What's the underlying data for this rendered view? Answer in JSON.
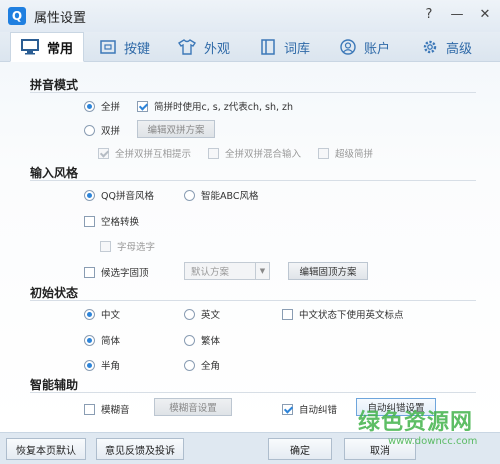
{
  "window": {
    "logo": "Q",
    "title": "属性设置",
    "controls": [
      "?",
      "—",
      "✕"
    ]
  },
  "tabs": [
    {
      "label": "常用",
      "icon": "monitor-icon",
      "active": true
    },
    {
      "label": "按键",
      "icon": "keyboard-icon",
      "active": false
    },
    {
      "label": "外观",
      "icon": "shirt-icon",
      "active": false
    },
    {
      "label": "词库",
      "icon": "book-icon",
      "active": false
    },
    {
      "label": "账户",
      "icon": "user-icon",
      "active": false
    },
    {
      "label": "高级",
      "icon": "gear-icon",
      "active": false
    }
  ],
  "sections": {
    "pinyin_mode": {
      "title": "拼音模式",
      "quanpin": "全拼",
      "shuangpin": "双拼",
      "jianpin_option": "简拼时使用c, s, z代表ch, sh, zh",
      "edit_shuangpin": "编辑双拼方案",
      "sub_options": [
        "全拼双拼互相提示",
        "全拼双拼混合输入",
        "超级简拼"
      ]
    },
    "input_style": {
      "title": "输入风格",
      "qq_style": "QQ拼音风格",
      "abc_style": "智能ABC风格",
      "space_convert": "空格转换",
      "letter_select": "字母选字",
      "candidate_fixed": "候选字固顶",
      "scheme_select": "默认方案",
      "edit_fixed_scheme": "编辑固顶方案"
    },
    "initial_state": {
      "title": "初始状态",
      "chinese": "中文",
      "english": "英文",
      "cn_english_punct": "中文状态下使用英文标点",
      "simplified": "简体",
      "traditional": "繁体",
      "half_width": "半角",
      "full_width": "全角"
    },
    "smart_assist": {
      "title": "智能辅助",
      "fuzzy": "模糊音",
      "fuzzy_settings": "模糊音设置",
      "auto_correct": "自动纠错",
      "auto_correct_settings": "自动纠错设置"
    }
  },
  "footer": {
    "restore_defaults": "恢复本页默认",
    "feedback": "意见反馈及投诉",
    "ok": "确定",
    "cancel": "取消"
  },
  "watermark": {
    "text": "绿色资源网",
    "url": "www.downcc.com"
  },
  "colors": {
    "accent": "#2d84d9",
    "tab_inactive": "#2f6aa8",
    "watermark": "#43b34b"
  }
}
